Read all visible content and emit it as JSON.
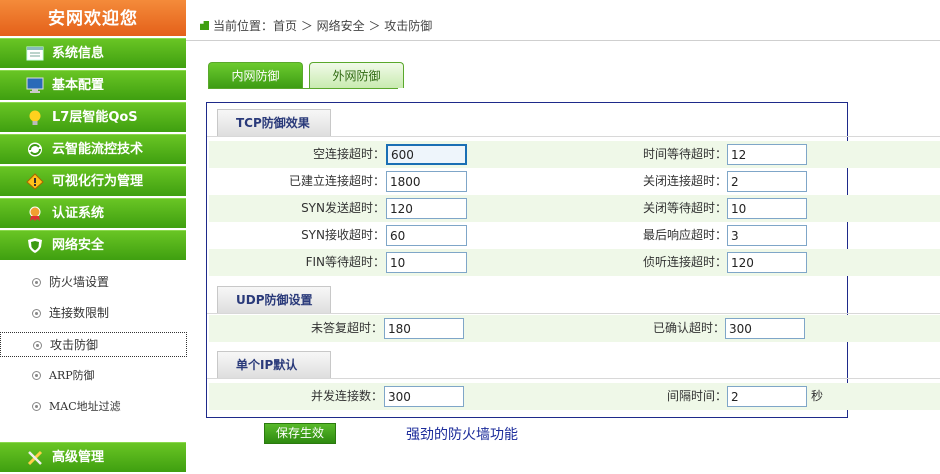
{
  "sidebar": {
    "title": "安网欢迎您",
    "items": [
      {
        "label": "系统信息",
        "icon": "system-info-icon"
      },
      {
        "label": "基本配置",
        "icon": "monitor-icon"
      },
      {
        "label": "L7层智能QoS",
        "icon": "lightbulb-icon"
      },
      {
        "label": "云智能流控技术",
        "icon": "cloud-flow-icon"
      },
      {
        "label": "可视化行为管理",
        "icon": "warning-icon"
      },
      {
        "label": "认证系统",
        "icon": "badge-icon"
      },
      {
        "label": "网络安全",
        "icon": "shield-icon"
      }
    ],
    "sub_items": [
      {
        "label": "防火墙设置"
      },
      {
        "label": "连接数限制"
      },
      {
        "label": "攻击防御"
      },
      {
        "label": "ARP防御"
      },
      {
        "label": "MAC地址过滤"
      }
    ],
    "advanced": {
      "label": "高级管理",
      "icon": "tools-icon"
    }
  },
  "breadcrumb": {
    "prefix": "当前位置：",
    "path": "首页 ＞ 网络安全 ＞ 攻击防御"
  },
  "tabs": {
    "internal": "内网防御",
    "external": "外网防御"
  },
  "tcp": {
    "header": "TCP防御效果",
    "rows": [
      {
        "l_label": "空连接超时：",
        "l_value": "600",
        "r_label": "时间等待超时：",
        "r_value": "12"
      },
      {
        "l_label": "已建立连接超时：",
        "l_value": "1800",
        "r_label": "关闭连接超时：",
        "r_value": "2"
      },
      {
        "l_label": "SYN发送超时：",
        "l_value": "120",
        "r_label": "关闭等待超时：",
        "r_value": "10"
      },
      {
        "l_label": "SYN接收超时：",
        "l_value": "60",
        "r_label": "最后响应超时：",
        "r_value": "3"
      },
      {
        "l_label": "FIN等待超时：",
        "l_value": "10",
        "r_label": "侦听连接超时：",
        "r_value": "120"
      }
    ]
  },
  "udp": {
    "header": "UDP防御设置",
    "l_label": "未答复超时：",
    "l_value": "180",
    "r_label": "已确认超时：",
    "r_value": "300"
  },
  "single_ip": {
    "header": "单个IP默认",
    "l_label": "并发连接数：",
    "l_value": "300",
    "r_label": "间隔时间：",
    "r_value": "2",
    "unit": "秒"
  },
  "actions": {
    "save": "保存生效"
  },
  "tagline": "强劲的防火墙功能"
}
